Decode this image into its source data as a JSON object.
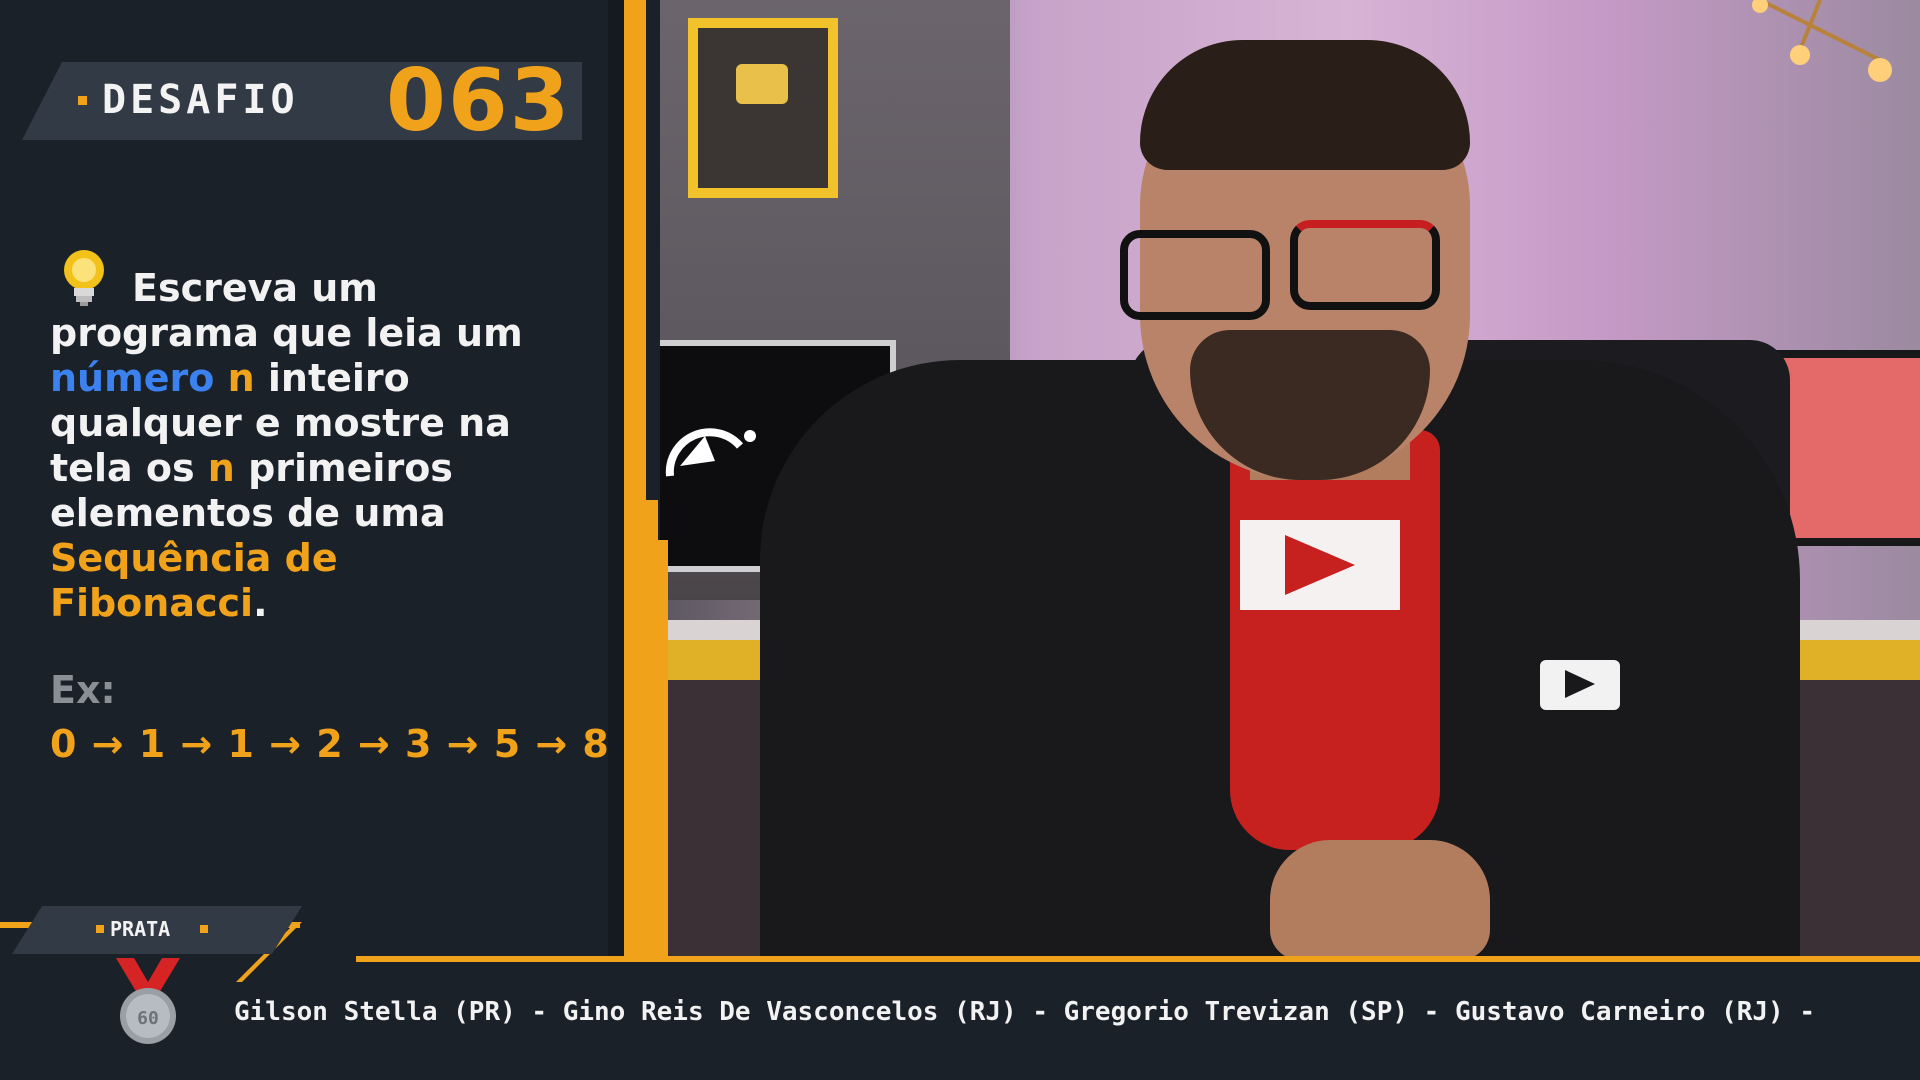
{
  "challenge": {
    "label": "DESAFIO",
    "number": "063"
  },
  "description": {
    "line1": "Escreva um",
    "line2": "programa que leia um",
    "line3_highlight1": "número",
    "line3_highlight2": "n",
    "line3_rest": "inteiro",
    "line4": "qualquer e mostre na",
    "line5_start": "tela  os",
    "line5_highlight": "n",
    "line5_rest": "primeiros",
    "line6": "elementos de uma",
    "line7_highlight": "Sequência de",
    "line8_highlight": "Fibonacci",
    "line8_end": "."
  },
  "example": {
    "label": "Ex:",
    "sequence": "0 → 1 → 1 → 2 → 3 → 5 → 8"
  },
  "supporters": {
    "tier": "PRATA",
    "medal_number": "60",
    "ticker": "Gilson Stella (PR) - Gino Reis De Vasconcelos (RJ) - Gregorio Trevizan (SP) - Gustavo Carneiro (RJ) -"
  },
  "icons": {
    "bulb": "lightbulb-icon",
    "medal": "medal-icon"
  },
  "colors": {
    "accent": "#f0a21b",
    "highlight_blue": "#3b82f0",
    "panel_bg": "#1b2129"
  }
}
